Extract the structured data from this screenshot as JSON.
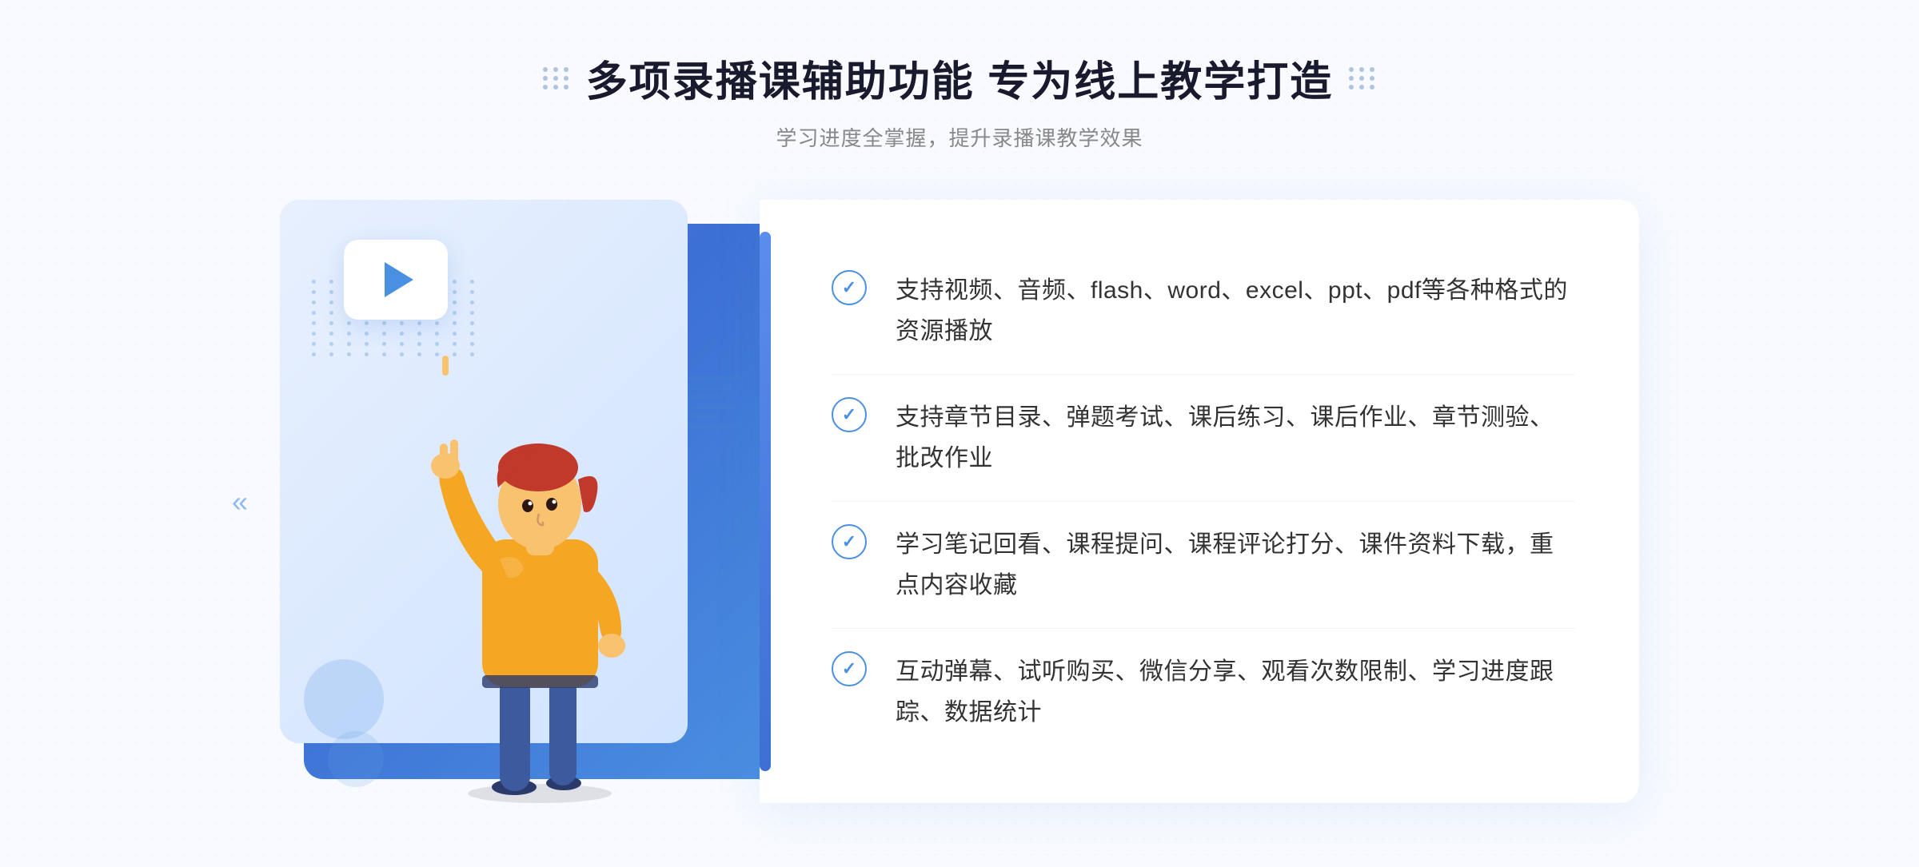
{
  "header": {
    "title": "多项录播课辅助功能 专为线上教学打造",
    "subtitle": "学习进度全掌握，提升录播课教学效果"
  },
  "features": [
    {
      "id": 1,
      "text": "支持视频、音频、flash、word、excel、ppt、pdf等各种格式的资源播放"
    },
    {
      "id": 2,
      "text": "支持章节目录、弹题考试、课后练习、课后作业、章节测验、批改作业"
    },
    {
      "id": 3,
      "text": "学习笔记回看、课程提问、课程评论打分、课件资料下载，重点内容收藏"
    },
    {
      "id": 4,
      "text": "互动弹幕、试听购买、微信分享、观看次数限制、学习进度跟踪、数据统计"
    }
  ],
  "decorative": {
    "left_arrows": "«",
    "dots_label": "dots-decoration"
  }
}
